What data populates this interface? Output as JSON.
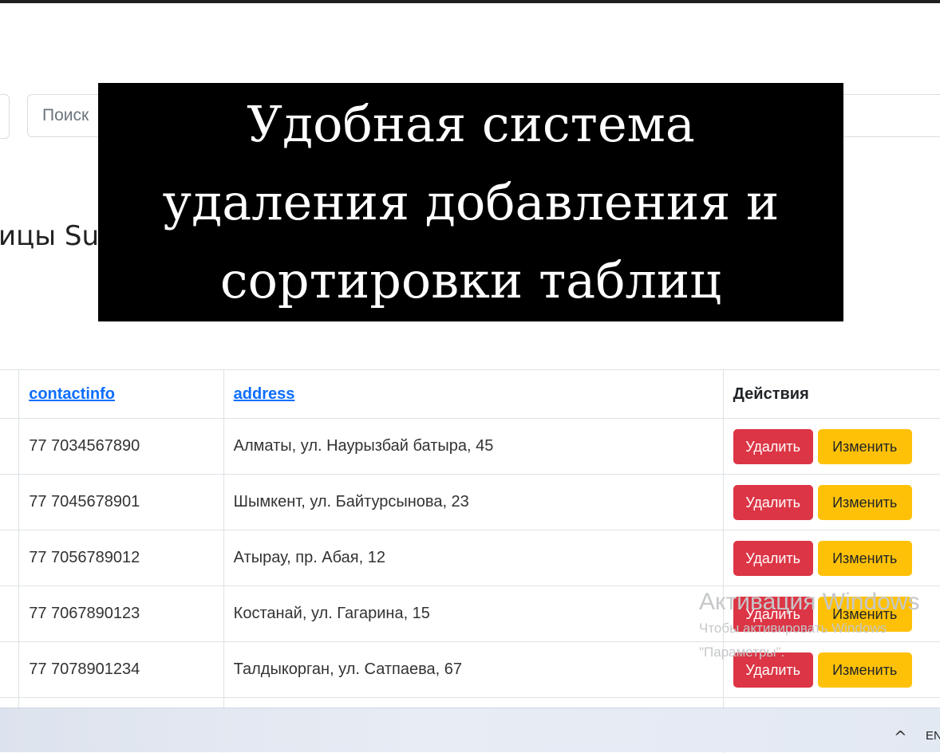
{
  "search": {
    "placeholder": "Поиск"
  },
  "page_title": "ицы Su",
  "overlay": {
    "lines": [
      "Удобная система",
      "удаления добавления и",
      "сортировки таблиц"
    ]
  },
  "table": {
    "headers": [
      "contactinfo",
      "address",
      "Действия"
    ],
    "rows": [
      {
        "contact": "77 7034567890",
        "address": "Алматы, ул. Наурызбай батыра, 45"
      },
      {
        "contact": "77 7045678901",
        "address": "Шымкент, ул. Байтурсынова, 23"
      },
      {
        "contact": "77 7056789012",
        "address": "Атырау, пр. Абая, 12"
      },
      {
        "contact": "77 7067890123",
        "address": "Костанай, ул. Гагарина, 15"
      },
      {
        "contact": "77 7078901234",
        "address": "Талдыкорган, ул. Сатпаева, 67"
      }
    ],
    "delete_label": "Удалить",
    "edit_label": "Изменить"
  },
  "watermark": {
    "title": "Активация Windows",
    "line1": "Чтобы активировать Windows",
    "line2": "\"Параметры\"."
  },
  "taskbar": {
    "chevron": "^",
    "lang": "EN"
  },
  "colors": {
    "delete": "#dc3545",
    "edit": "#ffc107",
    "link": "#0d6efd",
    "overlay_bg": "#000000"
  }
}
